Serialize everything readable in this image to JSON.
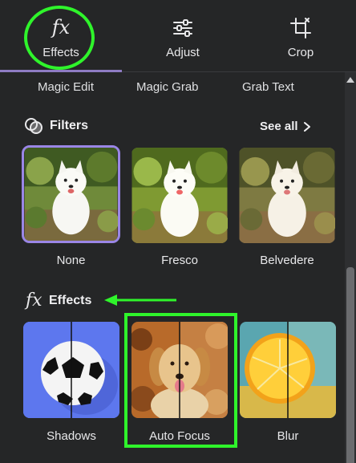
{
  "tabs": [
    {
      "label": "Effects",
      "icon": "fx-icon",
      "active": true
    },
    {
      "label": "Adjust",
      "icon": "sliders-icon"
    },
    {
      "label": "Crop",
      "icon": "crop-icon"
    }
  ],
  "fx_glyph": "fx",
  "subtools": [
    "Magic Edit",
    "Magic Grab",
    "Grab Text"
  ],
  "filters": {
    "title": "Filters",
    "see_all": "See all",
    "items": [
      "None",
      "Fresco",
      "Belvedere"
    ]
  },
  "effects": {
    "title": "Effects",
    "items": [
      "Shadows",
      "Auto Focus",
      "Blur"
    ]
  },
  "colors": {
    "background": "#252627",
    "accent": "#9a86e6",
    "annotation": "#2ff42b"
  }
}
